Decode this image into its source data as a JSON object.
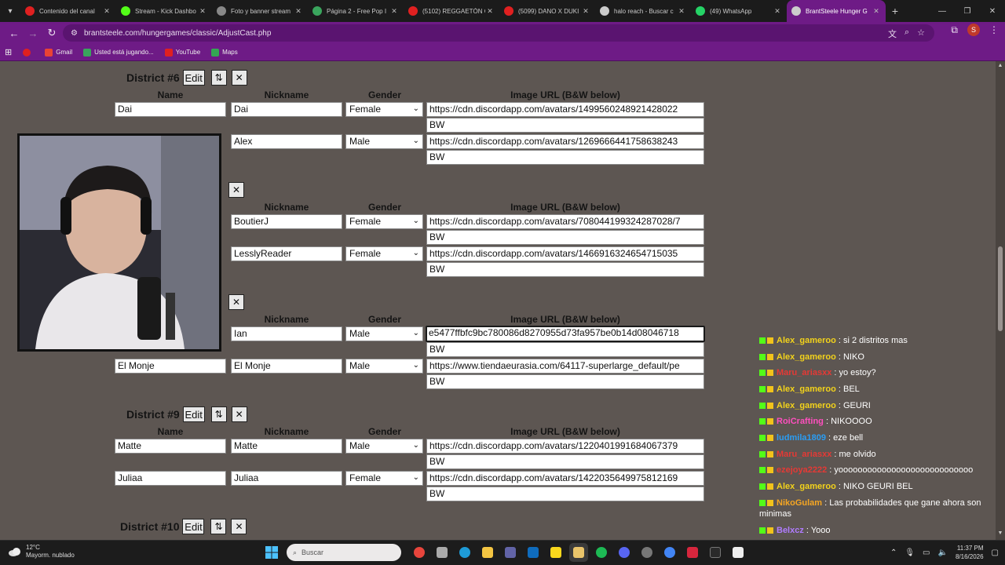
{
  "browser": {
    "tabs": [
      {
        "title": "Contenido del canal",
        "color": "#e02020"
      },
      {
        "title": "Stream - Kick Dashbo",
        "color": "#53fc18"
      },
      {
        "title": "Foto y banner stream",
        "color": "#888888"
      },
      {
        "title": "Página 2 - Free Pop I",
        "color": "#3aa55d"
      },
      {
        "title": "(5102) REGGAETÓN C",
        "color": "#e02020"
      },
      {
        "title": "(5099) DANO X DUKI",
        "color": "#e02020"
      },
      {
        "title": "halo reach - Buscar c",
        "color": "#cccccc"
      },
      {
        "title": "(49) WhatsApp",
        "color": "#25d366"
      }
    ],
    "active_tab": {
      "title": "BrantSteele Hunger G",
      "color": "#cccccc"
    },
    "url": "brantsteele.com/hungergames/classic/AdjustCast.php",
    "profile_initial": "S",
    "bookmarks": [
      {
        "label": "Gmail",
        "color": "#ea4335"
      },
      {
        "label": "Usted está jugando...",
        "color": "#3aa55d"
      },
      {
        "label": "YouTube",
        "color": "#e02020"
      },
      {
        "label": "Maps",
        "color": "#34a853"
      }
    ],
    "accent": "#6e1b86"
  },
  "page": {
    "headers": {
      "name": "Name",
      "nickname": "Nickname",
      "gender": "Gender",
      "image": "Image URL (B&W below)"
    },
    "buttons": {
      "edit": "Edit",
      "swap": "⇅",
      "remove": "✕"
    },
    "districts": [
      {
        "title": "District #6",
        "tributes": [
          {
            "name": "Dai",
            "nickname": "Dai",
            "gender": "Female",
            "image": "https://cdn.discordapp.com/avatars/1499560248921428022",
            "bw": "BW"
          },
          {
            "name": "",
            "nickname": "Alex",
            "gender": "Male",
            "image": "https://cdn.discordapp.com/avatars/1269666441758638243",
            "bw": "BW"
          }
        ]
      },
      {
        "title": "",
        "tributes": [
          {
            "name": "",
            "nickname": "BoutierJ",
            "gender": "Female",
            "image": "https://cdn.discordapp.com/avatars/708044199324287028/7",
            "bw": "BW"
          },
          {
            "name": "",
            "nickname": "LesslyReader",
            "gender": "Female",
            "image": "https://cdn.discordapp.com/avatars/1466916324654715035",
            "bw": "BW"
          }
        ]
      },
      {
        "title": "",
        "tributes": [
          {
            "name": "",
            "nickname": "Ian",
            "gender": "Male",
            "image": "e5477ffbfc9bc780086d8270955d73fa957be0b14d08046718",
            "bw": "BW"
          },
          {
            "name": "El Monje",
            "nickname": "El Monje",
            "gender": "Male",
            "image": "https://www.tiendaeurasia.com/64117-superlarge_default/pe",
            "bw": "BW"
          }
        ]
      },
      {
        "title": "District #9",
        "tributes": [
          {
            "name": "Matte",
            "nickname": "Matte",
            "gender": "Male",
            "image": "https://cdn.discordapp.com/avatars/1220401991684067379",
            "bw": "BW"
          },
          {
            "name": "Juliaa",
            "nickname": "Juliaa",
            "gender": "Female",
            "image": "https://cdn.discordapp.com/avatars/1422035649975812169",
            "bw": "BW"
          }
        ]
      },
      {
        "title": "District #10",
        "tributes": []
      }
    ]
  },
  "chat": [
    {
      "user": "Alex_gameroo",
      "text": ": si 2 distritos mas",
      "color": "#f2d21b"
    },
    {
      "user": "Alex_gameroo",
      "text": ": NIKO",
      "color": "#f2d21b"
    },
    {
      "user": "Maru_ariasxx",
      "text": ": yo estoy?",
      "color": "#e53935"
    },
    {
      "user": "Alex_gameroo",
      "text": ": BEL",
      "color": "#f2d21b"
    },
    {
      "user": "Alex_gameroo",
      "text": ": GEURI",
      "color": "#f2d21b"
    },
    {
      "user": "RoiCrafting",
      "text": ": NIKOOOO",
      "color": "#ff4fbf"
    },
    {
      "user": "ludmila1809",
      "text": ": eze bell",
      "color": "#2a9df4"
    },
    {
      "user": "Maru_ariasxx",
      "text": ": me olvido",
      "color": "#e53935"
    },
    {
      "user": "ezejoya2222",
      "text": ": yoooooooooooooooooooooooooooo",
      "color": "#e53935"
    },
    {
      "user": "Alex_gameroo",
      "text": ": NIKO GEURI BEL",
      "color": "#f2d21b"
    },
    {
      "user": "NikoGulam",
      "text": ": Las probabilidades que gane ahora son minimas",
      "color": "#f5a623"
    },
    {
      "user": "Belxcz",
      "text": ": Yooo",
      "color": "#b07cff"
    }
  ],
  "taskbar": {
    "temperature": "12°C",
    "weather": "Mayorm. nublado",
    "search_placeholder": "Buscar",
    "time": "11:37 PM",
    "date": "8/16/2026"
  }
}
